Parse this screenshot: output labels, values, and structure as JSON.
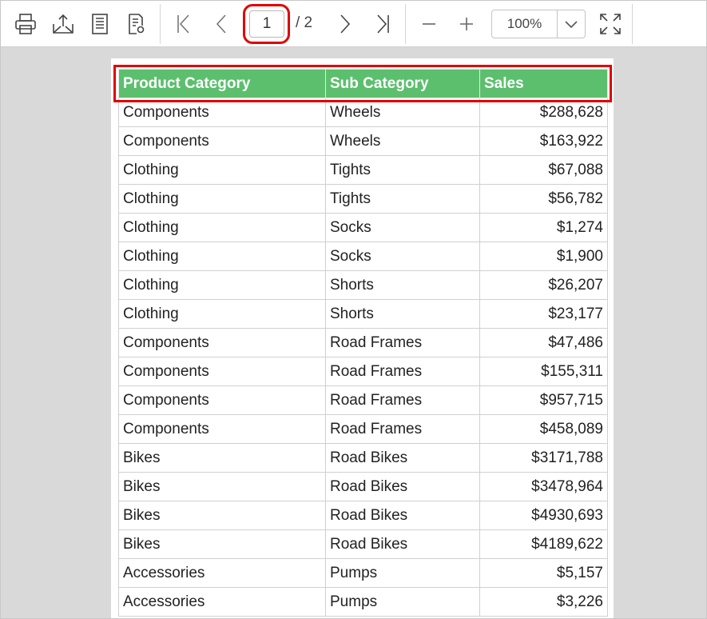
{
  "toolbar": {
    "buttons": [
      "print-icon",
      "export-icon",
      "page-setup-icon",
      "document-settings-icon",
      "first-page-icon",
      "previous-page-icon",
      "next-page-icon",
      "last-page-icon",
      "zoom-out-icon",
      "zoom-in-icon",
      "fit-page-icon"
    ],
    "current_page": "1",
    "page_total": "/ 2",
    "zoom_value": "100%"
  },
  "colors": {
    "header_bg": "#5cbf6e",
    "highlight": "#e00000",
    "canvas_bg": "#d9d9d9"
  },
  "report": {
    "columns": [
      "Product Category",
      "Sub Category",
      "Sales"
    ],
    "rows": [
      [
        "Components",
        "Wheels",
        "$288,628"
      ],
      [
        "Components",
        "Wheels",
        "$163,922"
      ],
      [
        "Clothing",
        "Tights",
        "$67,088"
      ],
      [
        "Clothing",
        "Tights",
        "$56,782"
      ],
      [
        "Clothing",
        "Socks",
        "$1,274"
      ],
      [
        "Clothing",
        "Socks",
        "$1,900"
      ],
      [
        "Clothing",
        "Shorts",
        "$26,207"
      ],
      [
        "Clothing",
        "Shorts",
        "$23,177"
      ],
      [
        "Components",
        "Road Frames",
        "$47,486"
      ],
      [
        "Components",
        "Road Frames",
        "$155,311"
      ],
      [
        "Components",
        "Road Frames",
        "$957,715"
      ],
      [
        "Components",
        "Road Frames",
        "$458,089"
      ],
      [
        "Bikes",
        "Road Bikes",
        "$3171,788"
      ],
      [
        "Bikes",
        "Road Bikes",
        "$3478,964"
      ],
      [
        "Bikes",
        "Road Bikes",
        "$4930,693"
      ],
      [
        "Bikes",
        "Road Bikes",
        "$4189,622"
      ],
      [
        "Accessories",
        "Pumps",
        "$5,157"
      ],
      [
        "Accessories",
        "Pumps",
        "$3,226"
      ]
    ]
  }
}
